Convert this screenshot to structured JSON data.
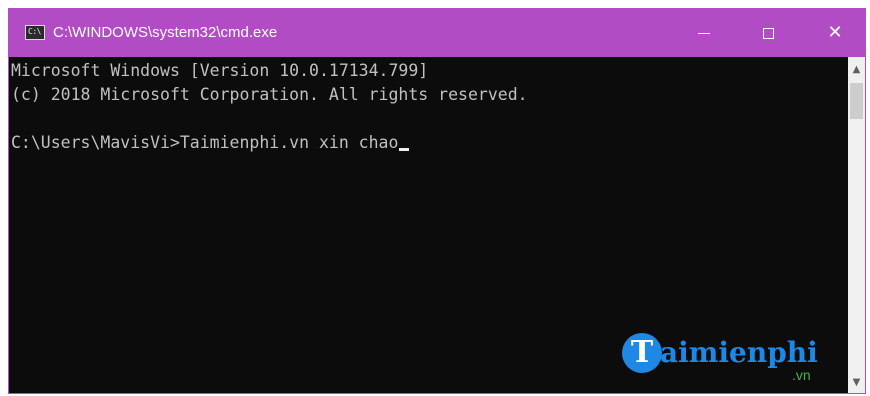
{
  "window": {
    "title": "C:\\WINDOWS\\system32\\cmd.exe",
    "icon": "cmd-icon",
    "icon_text": "C:\\",
    "controls": {
      "minimize": "minimize-icon",
      "maximize": "maximize-icon",
      "close": "✕"
    },
    "accent_color": "#b14cc4"
  },
  "console": {
    "lines": [
      "Microsoft Windows [Version 10.0.17134.799]",
      "(c) 2018 Microsoft Corporation. All rights reserved.",
      "",
      "C:\\Users\\MavisVi>Taimienphi.vn xin chao"
    ],
    "background": "#0c0c0c",
    "foreground": "#c0c0c0"
  },
  "scrollbar": {
    "up": "▲",
    "down": "▼"
  },
  "watermark": {
    "logo_letter": "T",
    "text": "aimienphi",
    "suffix": ".vn"
  }
}
